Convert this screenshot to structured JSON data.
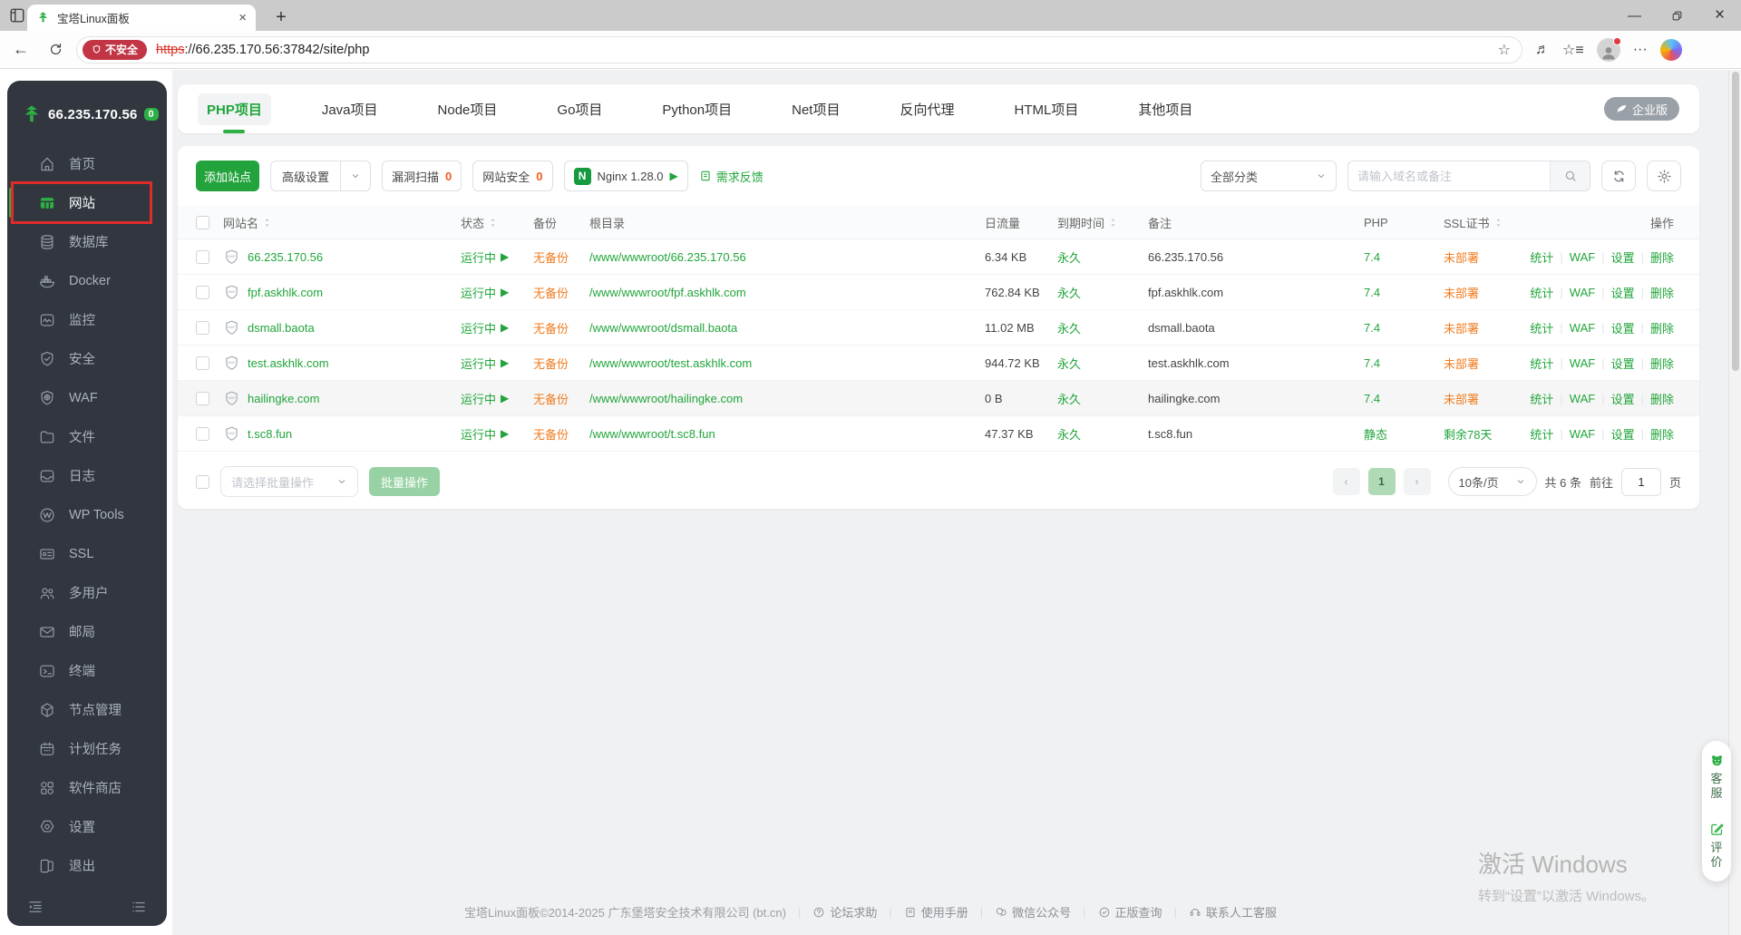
{
  "colors": {
    "accent_green": "#20a53a",
    "warn_orange": "#f07c1f",
    "danger_red": "#c13545",
    "sidebar_bg": "#31363f"
  },
  "browser": {
    "tab_title": "宝塔Linux面板",
    "security_badge": "不安全",
    "url_scheme": "https",
    "url_rest": "://66.235.170.56:37842/site/php"
  },
  "sidebar": {
    "server_ip": "66.235.170.56",
    "badge_count": "0",
    "items": [
      {
        "key": "home",
        "label": "首页"
      },
      {
        "key": "site",
        "label": "网站",
        "active": true,
        "annotated": true
      },
      {
        "key": "database",
        "label": "数据库"
      },
      {
        "key": "docker",
        "label": "Docker"
      },
      {
        "key": "monitor",
        "label": "监控"
      },
      {
        "key": "security",
        "label": "安全"
      },
      {
        "key": "waf",
        "label": "WAF"
      },
      {
        "key": "files",
        "label": "文件"
      },
      {
        "key": "logs",
        "label": "日志"
      },
      {
        "key": "wp",
        "label": "WP Tools"
      },
      {
        "key": "ssl",
        "label": "SSL"
      },
      {
        "key": "users",
        "label": "多用户"
      },
      {
        "key": "mail",
        "label": "邮局"
      },
      {
        "key": "terminal",
        "label": "终端"
      },
      {
        "key": "node",
        "label": "节点管理"
      },
      {
        "key": "cron",
        "label": "计划任务"
      },
      {
        "key": "store",
        "label": "软件商店"
      },
      {
        "key": "settings",
        "label": "设置"
      },
      {
        "key": "logout",
        "label": "退出"
      }
    ]
  },
  "tabs": {
    "items": [
      {
        "key": "php",
        "label": "PHP项目",
        "active": true
      },
      {
        "key": "java",
        "label": "Java项目"
      },
      {
        "key": "node",
        "label": "Node项目"
      },
      {
        "key": "go",
        "label": "Go项目"
      },
      {
        "key": "python",
        "label": "Python项目"
      },
      {
        "key": "net",
        "label": "Net项目"
      },
      {
        "key": "proxy",
        "label": "反向代理"
      },
      {
        "key": "html",
        "label": "HTML项目"
      },
      {
        "key": "other",
        "label": "其他项目"
      }
    ],
    "edition_badge": "企业版"
  },
  "toolbar": {
    "add_site": "添加站点",
    "advanced": "高级设置",
    "vuln_scan_label": "漏洞扫描",
    "vuln_scan_count": "0",
    "site_security_label": "网站安全",
    "site_security_count": "0",
    "nginx_label": "Nginx 1.28.0",
    "feedback": "需求反馈",
    "category": "全部分类",
    "search_placeholder": "请输入域名或备注"
  },
  "table": {
    "headers": [
      {
        "key": "site-name",
        "label": "网站名",
        "sortable": true
      },
      {
        "key": "status",
        "label": "状态",
        "sortable": true
      },
      {
        "key": "backup",
        "label": "备份",
        "sortable": false
      },
      {
        "key": "root-path",
        "label": "根目录",
        "sortable": false
      },
      {
        "key": "traffic",
        "label": "日流量",
        "sortable": false
      },
      {
        "key": "expire",
        "label": "到期时间",
        "sortable": true
      },
      {
        "key": "note",
        "label": "备注",
        "sortable": false
      },
      {
        "key": "php",
        "label": "PHP",
        "sortable": false
      },
      {
        "key": "ssl",
        "label": "SSL证书",
        "sortable": true
      },
      {
        "key": "actions",
        "label": "操作",
        "sortable": false
      }
    ],
    "rows": [
      {
        "name": "66.235.170.56",
        "status": "运行中",
        "backup": "无备份",
        "path": "/www/wwwroot/66.235.170.56",
        "traffic": "6.34 KB",
        "expire": "永久",
        "note": "66.235.170.56",
        "php": "7.4",
        "ssl": "未部署",
        "ssl_state": "warn",
        "highlight": false
      },
      {
        "name": "fpf.askhlk.com",
        "status": "运行中",
        "backup": "无备份",
        "path": "/www/wwwroot/fpf.askhlk.com",
        "traffic": "762.84 KB",
        "expire": "永久",
        "note": "fpf.askhlk.com",
        "php": "7.4",
        "ssl": "未部署",
        "ssl_state": "warn",
        "highlight": false
      },
      {
        "name": "dsmall.baota",
        "status": "运行中",
        "backup": "无备份",
        "path": "/www/wwwroot/dsmall.baota",
        "traffic": "11.02 MB",
        "expire": "永久",
        "note": "dsmall.baota",
        "php": "7.4",
        "ssl": "未部署",
        "ssl_state": "warn",
        "highlight": false
      },
      {
        "name": "test.askhlk.com",
        "status": "运行中",
        "backup": "无备份",
        "path": "/www/wwwroot/test.askhlk.com",
        "traffic": "944.72 KB",
        "expire": "永久",
        "note": "test.askhlk.com",
        "php": "7.4",
        "ssl": "未部署",
        "ssl_state": "warn",
        "highlight": false
      },
      {
        "name": "hailingke.com",
        "status": "运行中",
        "backup": "无备份",
        "path": "/www/wwwroot/hailingke.com",
        "traffic": "0 B",
        "expire": "永久",
        "note": "hailingke.com",
        "php": "7.4",
        "ssl": "未部署",
        "ssl_state": "warn",
        "highlight": true
      },
      {
        "name": "t.sc8.fun",
        "status": "运行中",
        "backup": "无备份",
        "path": "/www/wwwroot/t.sc8.fun",
        "traffic": "47.37 KB",
        "expire": "永久",
        "note": "t.sc8.fun",
        "php": "静态",
        "ssl": "剩余78天",
        "ssl_state": "ok",
        "highlight": false
      }
    ],
    "row_actions": [
      "统计",
      "WAF",
      "设置",
      "删除"
    ]
  },
  "batch": {
    "placeholder": "请选择批量操作",
    "button": "批量操作"
  },
  "pagination": {
    "page": "1",
    "page_size": "10条/页",
    "total": "共 6 条",
    "goto_label": "前往",
    "page_input": "1",
    "page_suffix": "页"
  },
  "footer": {
    "copyright": "宝塔Linux面板©2014-2025 广东堡塔安全技术有限公司 (bt.cn)",
    "links": [
      {
        "key": "forum-help",
        "icon": "help",
        "label": "论坛求助"
      },
      {
        "key": "manual",
        "icon": "manual",
        "label": "使用手册"
      },
      {
        "key": "wechat",
        "icon": "wechat",
        "label": "微信公众号"
      },
      {
        "key": "genuine-check",
        "icon": "verify",
        "label": "正版查询"
      },
      {
        "key": "contact-support",
        "icon": "service",
        "label": "联系人工客服"
      }
    ]
  },
  "watermark": {
    "title": "激活 Windows",
    "subtitle": "转到“设置”以激活 Windows。"
  },
  "float_panel": {
    "support": "客服",
    "feedback": "评价"
  }
}
